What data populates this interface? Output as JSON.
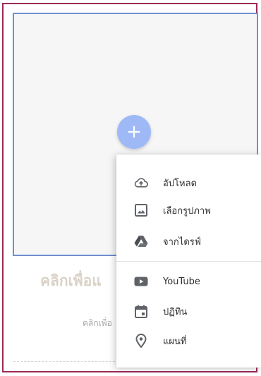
{
  "card": {
    "title": "คลิกเพื่อแ",
    "subtitle": "คลิกเพื่อ"
  },
  "add_button": {
    "glyph": "+"
  },
  "menu": {
    "items": [
      {
        "label": "อัปโหลด",
        "icon": "cloud-upload-icon"
      },
      {
        "label": "เลือกรูปภาพ",
        "icon": "image-icon"
      },
      {
        "label": "จากไดรฟ์",
        "icon": "drive-icon"
      },
      {
        "label": "YouTube",
        "icon": "youtube-icon"
      },
      {
        "label": "ปฏิทิน",
        "icon": "calendar-icon"
      },
      {
        "label": "แผนที่",
        "icon": "map-pin-icon"
      }
    ]
  },
  "colors": {
    "frame_border": "#9b2a55",
    "image_border": "#6f8fd0",
    "fab": "#9fb9f7",
    "icon": "#5f6368"
  }
}
